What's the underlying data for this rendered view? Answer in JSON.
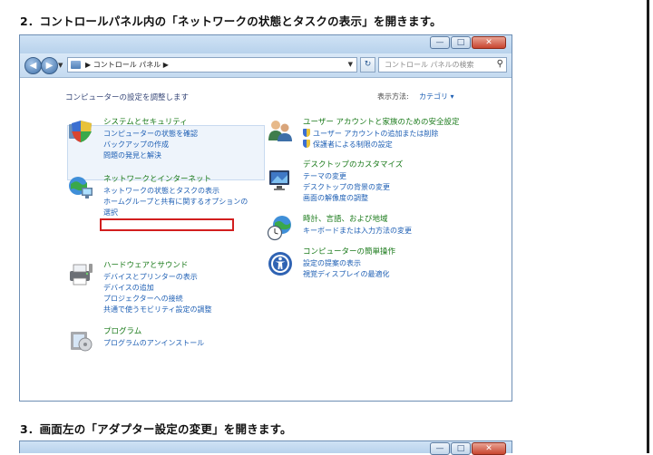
{
  "instructions": {
    "step2": "2．コントロールパネル内の「ネットワークの状態とタスクの表示」を開きます。",
    "step3": "3．画面左の「アダプター設定の変更」を開きます。"
  },
  "window": {
    "caption_buttons": [
      "—",
      "□",
      "✕"
    ],
    "address": "▶ コントロール パネル ▶",
    "search_placeholder": "コントロール パネルの検索",
    "content_title": "コンピューターの設定を調整します",
    "view_label": "表示方法:",
    "view_value": "カテゴリ ▾",
    "categories": [
      {
        "title": "システムとセキュリティ",
        "links": [
          "コンピューターの状態を確認",
          "バックアップの作成",
          "問題の発見と解決"
        ]
      },
      {
        "title": "ネットワークとインターネット",
        "links": [
          "ネットワークの状態とタスクの表示",
          "ホームグループと共有に関するオプションの",
          "選択"
        ]
      },
      {
        "title": "ハードウェアとサウンド",
        "links": [
          "デバイスとプリンターの表示",
          "デバイスの追加",
          "プロジェクターへの接続",
          "共通で使うモビリティ設定の調整"
        ]
      },
      {
        "title": "プログラム",
        "links": [
          "プログラムのアンインストール"
        ]
      },
      {
        "title": "ユーザー アカウントと家族のための安全設定",
        "links": [
          "ユーザー アカウントの追加または削除",
          "保護者による制限の設定"
        ]
      },
      {
        "title": "デスクトップのカスタマイズ",
        "links": [
          "テーマの変更",
          "デスクトップの背景の変更",
          "画面の解像度の調整"
        ]
      },
      {
        "title": "時計、言語、および地域",
        "links": [
          "キーボードまたは入力方法の変更"
        ]
      },
      {
        "title": "コンピューターの簡単操作",
        "links": [
          "設定の提案の表示",
          "視覚ディスプレイの最適化"
        ]
      }
    ]
  },
  "icons": {
    "system": "shield-pc-icon",
    "network": "network-globe-icon",
    "hardware": "printer-icon",
    "programs": "programs-icon",
    "users": "users-icon",
    "desktop": "monitor-icon",
    "clock": "clock-globe-icon",
    "ease": "ease-of-access-icon"
  },
  "colors": {
    "highlight_box": "#d21e1e",
    "category_title": "#1a7a1a",
    "link": "#1e5fb4"
  }
}
